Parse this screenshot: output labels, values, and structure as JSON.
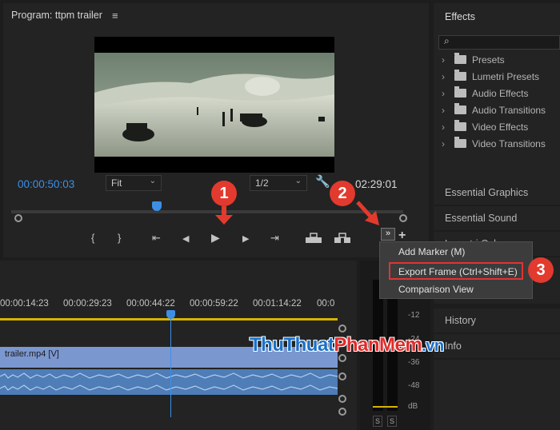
{
  "program_monitor": {
    "title": "Program: ttpm trailer",
    "menu_icon": "≡",
    "current_timecode": "00:00:50:03",
    "fit_option": "Fit",
    "resolution": "1/2",
    "duration_timecode": "02:29:01"
  },
  "transport": {
    "mark_in": "{",
    "mark_out": "}",
    "go_to_in": "⇤",
    "step_back": "◀",
    "play": "▶",
    "step_forward": "▶",
    "go_to_out": "⇥",
    "overflow": "»",
    "plus": "+"
  },
  "effects_panel": {
    "title": "Effects",
    "search_icon": "⌕",
    "items": [
      {
        "label": "Presets"
      },
      {
        "label": "Lumetri Presets"
      },
      {
        "label": "Audio Effects"
      },
      {
        "label": "Audio Transitions"
      },
      {
        "label": "Video Effects"
      },
      {
        "label": "Video Transitions"
      }
    ]
  },
  "side_panels": {
    "essential_graphics": "Essential Graphics",
    "essential_sound": "Essential Sound",
    "lumetri_color": "Lumetri Color",
    "history": "History",
    "info": "Info"
  },
  "context_menu": {
    "items": [
      {
        "label": "Add Marker (M)"
      },
      {
        "label": "Export Frame (Ctrl+Shift+E)"
      },
      {
        "label": "Comparison View"
      }
    ]
  },
  "timeline": {
    "ruler": [
      "00:00:14:23",
      "00:00:29:23",
      "00:00:44:22",
      "00:00:59:22",
      "00:01:14:22",
      "00:0"
    ],
    "video_clip_label": "trailer.mp4 [V]"
  },
  "audio_meters": {
    "labels": [
      "-12",
      "-24",
      "-36",
      "-48",
      "dB"
    ],
    "solo_left": "S",
    "solo_right": "S"
  },
  "annotations": {
    "step_1": "1",
    "step_2": "2",
    "step_3": "3"
  },
  "watermark": {
    "part1": "ThuThuat",
    "part2": "PhanMem",
    "part3": ".vn"
  },
  "colors": {
    "accent_blue": "#3d8fe6",
    "badge_red": "#e23a2e",
    "timeline_yellow": "#d6b400",
    "video_clip": "#7b97cf",
    "audio_clip": "#4e7db8"
  }
}
